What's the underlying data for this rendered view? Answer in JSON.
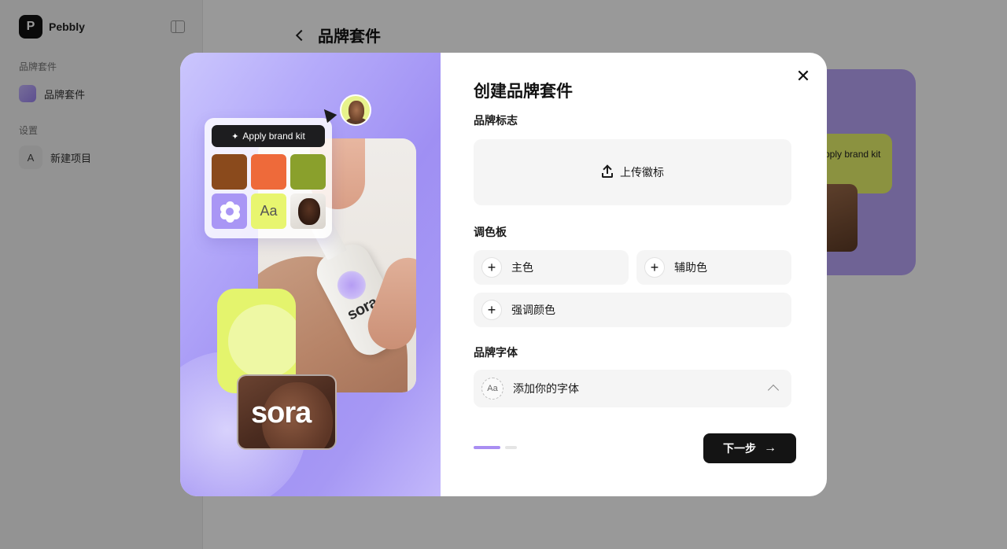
{
  "app": {
    "logo_text": "Pebbly",
    "sidebar_section_1": "品牌套件",
    "sidebar_item_1": "品牌套件",
    "sidebar_section_2": "设置",
    "sidebar_item_2": "新建项目",
    "page_title": "品牌套件",
    "bg_card_text": "Apply brand kit"
  },
  "modal": {
    "title": "创建品牌套件",
    "logo_section": {
      "label": "品牌标志",
      "upload_label": "上传徽标"
    },
    "palette_section": {
      "label": "调色板",
      "buttons": [
        "主色",
        "辅助色",
        "强调颜色"
      ]
    },
    "font_section": {
      "label": "品牌字体",
      "placeholder": "添加你的字体",
      "badge": "Aa"
    },
    "next_button": "下一步",
    "progress": {
      "current_step": 1,
      "total_steps": 2
    }
  },
  "illustration": {
    "apply_pill": "Apply brand kit",
    "font_tile": "Aa",
    "bottle_brand": "sora",
    "banner_brand": "sora",
    "swatches": [
      "#8a4a1c",
      "#ee6a3a",
      "#8aa02c"
    ]
  },
  "colors": {
    "accent": "#a98ef2",
    "primary_button": "#141414",
    "field_bg": "#f5f5f5",
    "lime": "#e4f46d"
  }
}
